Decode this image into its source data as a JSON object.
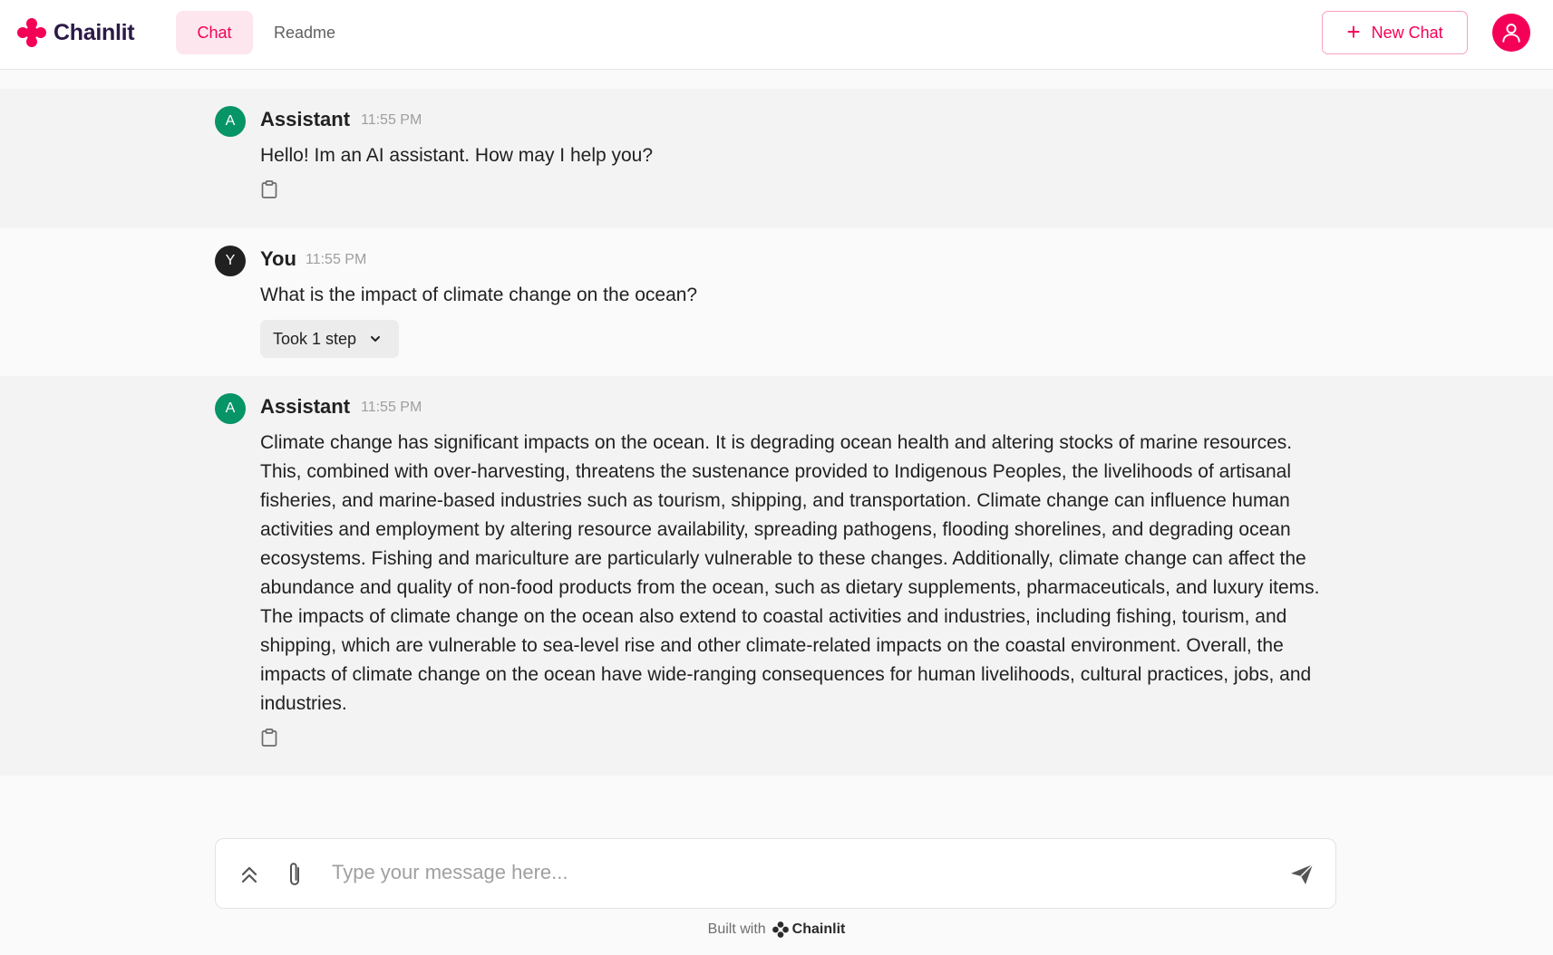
{
  "header": {
    "logo_text": "Chainlit",
    "tabs": [
      {
        "label": "Chat",
        "active": true
      },
      {
        "label": "Readme",
        "active": false
      }
    ],
    "new_chat_label": "New Chat"
  },
  "messages": [
    {
      "avatar_letter": "A",
      "author": "Assistant",
      "time": "11:55 PM",
      "content": "Hello! Im an AI assistant. How may I help you?"
    },
    {
      "avatar_letter": "Y",
      "author": "You",
      "time": "11:55 PM",
      "content": "What is the impact of climate change on the ocean?",
      "steps_label": "Took 1 step"
    },
    {
      "avatar_letter": "A",
      "author": "Assistant",
      "time": "11:55 PM",
      "content": "Climate change has significant impacts on the ocean. It is degrading ocean health and altering stocks of marine resources. This, combined with over-harvesting, threatens the sustenance provided to Indigenous Peoples, the livelihoods of artisanal fisheries, and marine-based industries such as tourism, shipping, and transportation. Climate change can influence human activities and employment by altering resource availability, spreading pathogens, flooding shorelines, and degrading ocean ecosystems. Fishing and mariculture are particularly vulnerable to these changes. Additionally, climate change can affect the abundance and quality of non-food products from the ocean, such as dietary supplements, pharmaceuticals, and luxury items. The impacts of climate change on the ocean also extend to coastal activities and industries, including fishing, tourism, and shipping, which are vulnerable to sea-level rise and other climate-related impacts on the coastal environment. Overall, the impacts of climate change on the ocean have wide-ranging consequences for human livelihoods, cultural practices, jobs, and industries."
    }
  ],
  "composer": {
    "placeholder": "Type your message here..."
  },
  "footer": {
    "built_with": "Built with",
    "brand": "Chainlit"
  },
  "colors": {
    "accent": "#f50057",
    "assistant_avatar": "#079466",
    "user_avatar": "#212121"
  },
  "icons": [
    "chainlit-logo-icon",
    "user-icon",
    "plus-icon",
    "copy-icon",
    "chevron-down-icon",
    "double-chevron-up-icon",
    "paperclip-icon",
    "send-icon"
  ]
}
